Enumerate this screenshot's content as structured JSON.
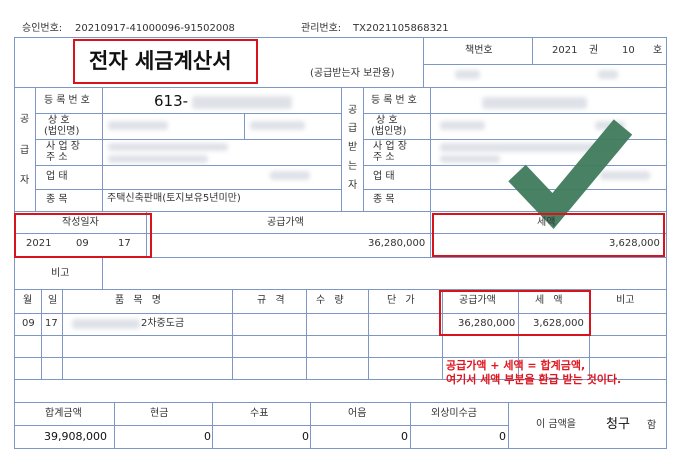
{
  "header": {
    "approval_label": "승인번호:",
    "approval_no": "20210917-41000096-91502008",
    "mgmt_label": "관리번호:",
    "mgmt_no": "TX2021105868321"
  },
  "title": "전자 세금계산서",
  "copy_note": "(공급받는자 보관용)",
  "book": {
    "label": "책번호",
    "year": "2021",
    "kwon": "권",
    "ho_no": "10",
    "ho": "호"
  },
  "supplier": {
    "side_label": [
      "공",
      "급",
      "자"
    ],
    "reg_label": "등록번호",
    "reg_no": "613-",
    "name_label": [
      "상 호",
      "(법인명)"
    ],
    "addr_label": [
      "사 업 장",
      "주 소"
    ],
    "biz_type_label": "업 태",
    "item_label": "종 목",
    "item_value": "주택신축판매(토지보유5년미만)"
  },
  "receiver": {
    "side_label": [
      "공",
      "급",
      "받",
      "는",
      "자"
    ],
    "reg_label": "등록번호",
    "name_label": [
      "상 호",
      "(법인명)"
    ],
    "addr_label": [
      "사 업 장",
      "주 소"
    ],
    "biz_type_label": "업 태",
    "item_label": "종 목"
  },
  "written": {
    "label": "작성일자",
    "year": "2021",
    "month": "09",
    "day": "17"
  },
  "supply_amount_label": "공급가액",
  "supply_amount": "36,280,000",
  "tax_label": "세액",
  "tax_amount": "3,628,000",
  "memo_label": "비고",
  "items_header": {
    "month": "월",
    "day": "일",
    "name": "품 목 명",
    "spec": "규 격",
    "qty": "수 량",
    "price": "단 가",
    "supply": "공급가액",
    "tax": "세 액",
    "note": "비고"
  },
  "item_row": {
    "month": "09",
    "day": "17",
    "name_suffix": "2차중도금",
    "supply": "36,280,000",
    "tax": "3,628,000"
  },
  "annotation": [
    "공급가액 + 세액 = 합계금액,",
    "여기서 세액 부분을 환급 받는 것이다."
  ],
  "totals": {
    "total_label": "합계금액",
    "cash_label": "현금",
    "check_label": "수표",
    "bill_label": "어음",
    "credit_label": "외상미수금",
    "total": "39,908,000",
    "cash": "0",
    "check": "0",
    "bill": "0",
    "credit": "0",
    "amount_phrase": "이 금액을",
    "claim": "청구",
    "ham": "함"
  },
  "colors": {
    "highlight": "#d8131b",
    "grid": "#7e96c4",
    "checkmark": "#3f7a5c",
    "annotation": "#e0151f"
  },
  "icons": [
    "checkmark-icon"
  ]
}
